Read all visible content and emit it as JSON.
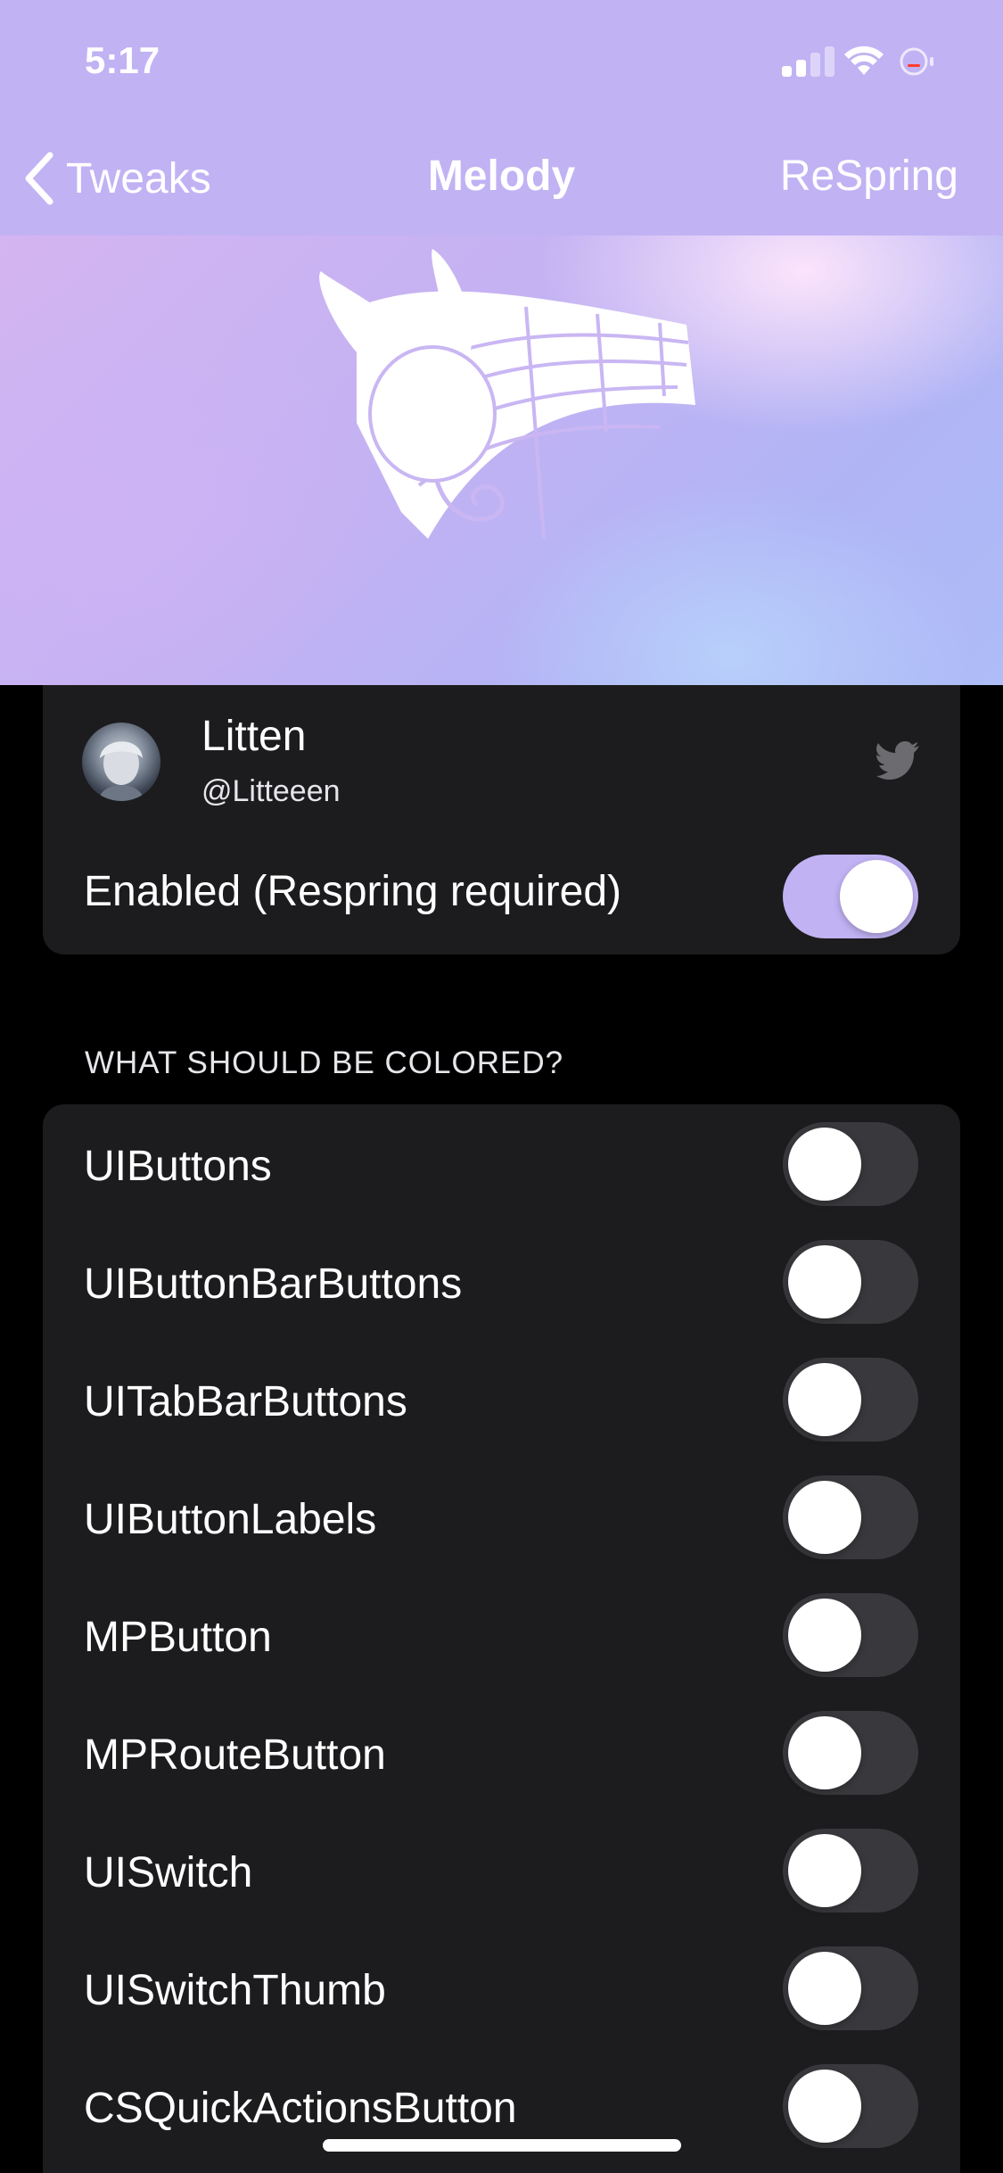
{
  "status_bar": {
    "time": "5:17"
  },
  "nav": {
    "back_label": "Tweaks",
    "title": "Melody",
    "action_label": "ReSpring"
  },
  "author": {
    "name": "Litten",
    "handle": "@Litteeen"
  },
  "enable_row": {
    "label": "Enabled (Respring required)",
    "on": true
  },
  "section": {
    "header": "WHAT SHOULD BE COLORED?",
    "options": [
      {
        "label": "UIButtons",
        "on": false
      },
      {
        "label": "UIButtonBarButtons",
        "on": false
      },
      {
        "label": "UITabBarButtons",
        "on": false
      },
      {
        "label": "UIButtonLabels",
        "on": false
      },
      {
        "label": "MPButton",
        "on": false
      },
      {
        "label": "MPRouteButton",
        "on": false
      },
      {
        "label": "UISwitch",
        "on": false
      },
      {
        "label": "UISwitchThumb",
        "on": false
      },
      {
        "label": "CSQuickActionsButton",
        "on": false
      }
    ]
  },
  "colors": {
    "accent": "#c1b2f4",
    "background": "#000000",
    "card": "#1c1c1e",
    "switch_off": "#39393d"
  },
  "icons": {
    "back": "chevron-left-icon",
    "twitter": "twitter-bird-icon",
    "logo": "bunny-music-sheet-logo"
  }
}
